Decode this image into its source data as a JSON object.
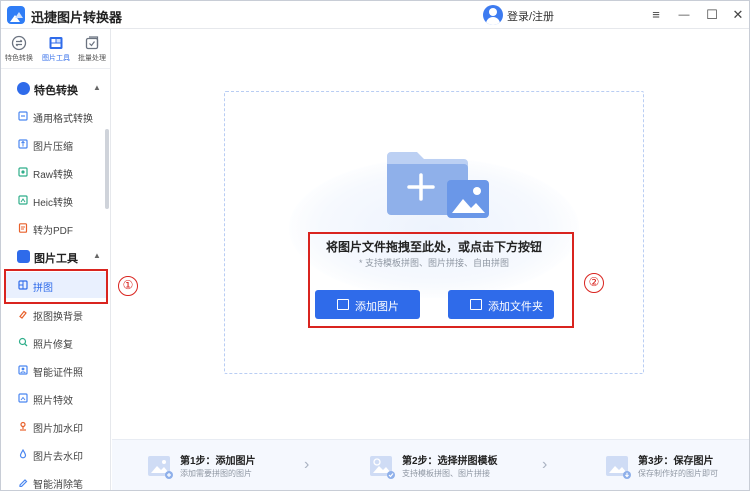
{
  "app": {
    "title": "迅捷图片转换器"
  },
  "titlebar": {
    "login": "登录/注册",
    "menu": "≡",
    "minimize": "—",
    "maximize": "☐",
    "close": "✕"
  },
  "topnav": [
    {
      "label": "特色转换",
      "icon": "convert-icon",
      "active": false
    },
    {
      "label": "图片工具",
      "icon": "image-tools-icon",
      "active": true
    },
    {
      "label": "批量处理",
      "icon": "batch-icon",
      "active": false
    }
  ],
  "sidebar": {
    "sections": [
      {
        "label": "特色转换",
        "chevron": "▲"
      },
      {
        "label": "图片工具",
        "chevron": "▲"
      }
    ],
    "items": [
      {
        "label": "通用格式转换"
      },
      {
        "label": "图片压缩"
      },
      {
        "label": "Raw转换"
      },
      {
        "label": "Heic转换"
      },
      {
        "label": "转为PDF"
      },
      {
        "label": "拼图"
      },
      {
        "label": "抠图换背景"
      },
      {
        "label": "照片修复"
      },
      {
        "label": "智能证件照"
      },
      {
        "label": "照片特效"
      },
      {
        "label": "图片加水印"
      },
      {
        "label": "图片去水印"
      },
      {
        "label": "智能消除笔"
      }
    ]
  },
  "dropzone": {
    "title": "将图片文件拖拽至此处，或点击下方按钮",
    "hint": "* 支持模板拼图、图片拼接、自由拼图",
    "add_images": "添加图片",
    "add_folder": "添加文件夹"
  },
  "annotations": {
    "one": "①",
    "two": "②"
  },
  "steps": [
    {
      "title": "第1步：添加图片",
      "desc": "添加需要拼图的图片"
    },
    {
      "title": "第2步：选择拼图模板",
      "desc": "支持模板拼图、图片拼接"
    },
    {
      "title": "第3步：保存图片",
      "desc": "保存制作好的图片即可"
    }
  ],
  "colors": {
    "accent": "#2f6bea",
    "annotation": "#d9241f"
  }
}
